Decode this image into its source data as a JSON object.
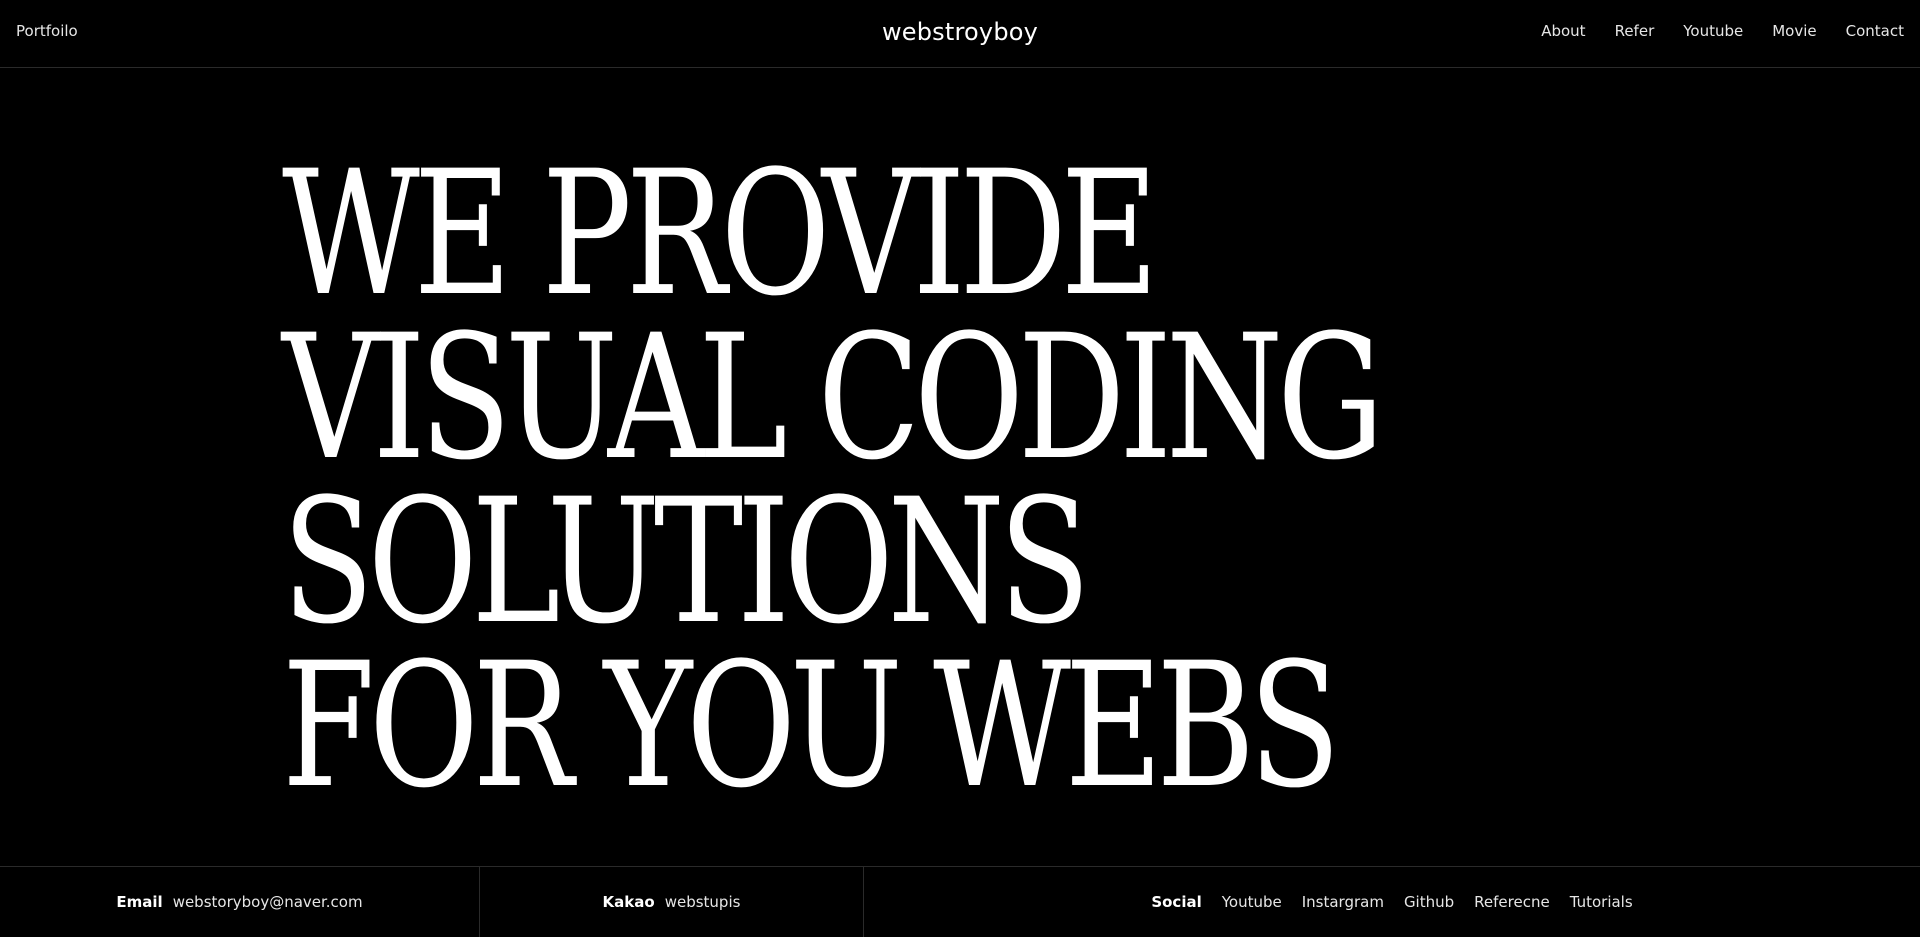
{
  "header": {
    "left_link": "Portfoilo",
    "logo": "webstroyboy",
    "nav": [
      "About",
      "Refer",
      "Youtube",
      "Movie",
      "Contact"
    ]
  },
  "hero": {
    "lines": [
      "WE PROVIDE",
      "VISUAL CODING",
      "SOLUTIONS",
      "FOR YOU WEBS"
    ]
  },
  "footer": {
    "email_label": "Email",
    "email_value": "webstoryboy@naver.com",
    "kakao_label": "Kakao",
    "kakao_value": "webstupis",
    "social_label": "Social",
    "social_links": [
      "Youtube",
      "Instargram",
      "Github",
      "Referecne",
      "Tutorials"
    ]
  }
}
